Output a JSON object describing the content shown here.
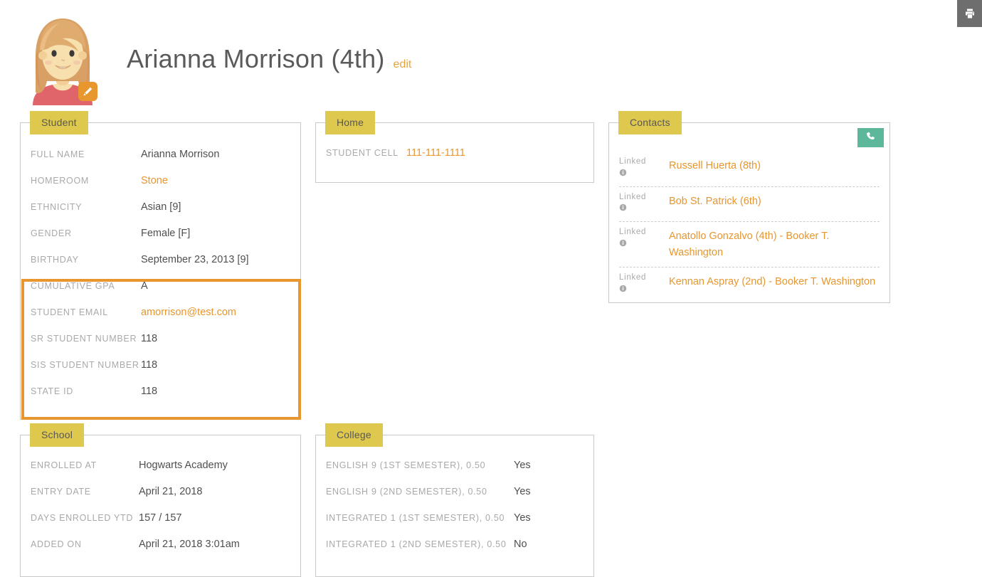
{
  "toolbar": {
    "print_label": "Print",
    "print_icon": "printer-icon"
  },
  "header": {
    "title": "Arianna Morrison (4th)",
    "edit_label": "edit",
    "avatar_alt": "student-avatar",
    "avatar_edit_icon": "pencil-icon"
  },
  "colors": {
    "panel_tab": "#dec84e",
    "accent_orange": "#e8962e",
    "highlight_border": "#e8962e",
    "phone_button_green": "#5cb79b",
    "print_button_gray": "#6e6e6e",
    "label_gray": "#a9a9a9",
    "value_gray": "#4f4f4f"
  },
  "panels": {
    "student": {
      "tab": "Student",
      "rows": [
        {
          "label": "Full Name",
          "value": "Arianna Morrison",
          "link": false
        },
        {
          "label": "Homeroom",
          "value": "Stone",
          "link": true
        },
        {
          "label": "Ethnicity",
          "value": "Asian [9]",
          "link": false
        },
        {
          "label": "Gender",
          "value": "Female [F]",
          "link": false
        },
        {
          "label": "Birthday",
          "value": "September 23, 2013 [9]",
          "link": false
        },
        {
          "label": "Cumulative GPA",
          "value": "A",
          "link": false
        },
        {
          "label": "Student Email",
          "value": "amorrison@test.com",
          "link": true
        },
        {
          "label": "SR Student Number",
          "value": "118",
          "link": false
        },
        {
          "label": "SIS Student Number",
          "value": "118",
          "link": false
        },
        {
          "label": "State ID",
          "value": "118",
          "link": false
        }
      ]
    },
    "home": {
      "tab": "Home",
      "rows": [
        {
          "label": "Student Cell",
          "value": "111-111-1111",
          "link": true
        }
      ]
    },
    "contacts": {
      "tab": "Contacts",
      "phone_icon": "phone-icon",
      "rows": [
        {
          "tag": "Linked",
          "name": "Russell Huerta (8th)",
          "icon": "info-icon"
        },
        {
          "tag": "Linked",
          "name": "Bob St. Patrick (6th)",
          "icon": "info-icon"
        },
        {
          "tag": "Linked",
          "name": "Anatollo Gonzalvo (4th) - Booker T. Washington",
          "icon": "info-icon"
        },
        {
          "tag": "Linked",
          "name": "Kennan Aspray (2nd) - Booker T. Washington",
          "icon": "info-icon"
        }
      ]
    },
    "school": {
      "tab": "School",
      "rows": [
        {
          "label": "Enrolled At",
          "value": "Hogwarts Academy",
          "link": false
        },
        {
          "label": "Entry Date",
          "value": "April 21, 2018",
          "link": false
        },
        {
          "label": "Days Enrolled YTD",
          "value": "157 / 157",
          "link": false
        },
        {
          "label": "Added On",
          "value": "April 21, 2018 3:01am",
          "link": false
        }
      ]
    },
    "college": {
      "tab": "College",
      "rows": [
        {
          "label": "English 9 (1st Semester), 0.50",
          "value": "Yes",
          "link": false
        },
        {
          "label": "English 9 (2nd Semester), 0.50",
          "value": "Yes",
          "link": false
        },
        {
          "label": "Integrated 1 (1st Semester), 0.50",
          "value": "Yes",
          "link": false
        },
        {
          "label": "Integrated 1 (2nd Semester), 0.50",
          "value": "No",
          "link": false
        }
      ]
    }
  }
}
